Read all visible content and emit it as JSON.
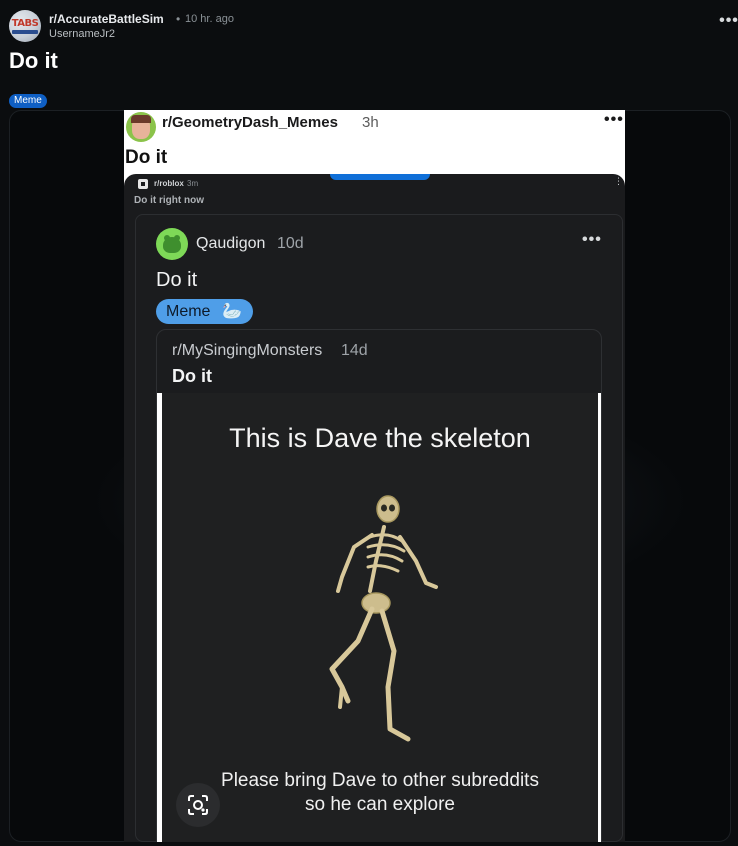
{
  "post": {
    "subreddit": "r/AccurateBattleSim",
    "separator": "•",
    "time": "10 hr. ago",
    "author": "UsernameJr2",
    "avatar_text": "TABS",
    "title": "Do it",
    "flair": "Meme",
    "more_label": "•••"
  },
  "embedded_screenshot": {
    "subreddit": "r/GeometryDash_Memes",
    "time": "3h",
    "title": "Do it",
    "more_label": "•••",
    "phone": {
      "subreddit": "r/roblox",
      "time": "3m",
      "title": "Do it right now",
      "more_label": "⋮",
      "inner_post": {
        "author": "Qaudigon",
        "time": "10d",
        "title": "Do it",
        "flair": "Meme",
        "flair_emoji": "🦢",
        "more_label": "•••",
        "crosspost": {
          "subreddit": "r/MySingingMonsters",
          "time": "14d",
          "title": "Do it",
          "meme_top_text": "This is Dave the skeleton",
          "meme_bottom_line1": "Please bring Dave to other subreddits",
          "meme_bottom_line2": "so he can explore"
        }
      }
    }
  },
  "icons": [
    "overflow-menu-icon",
    "google-lens-icon",
    "skeleton-image",
    "roblox-icon"
  ],
  "colors": {
    "background": "#0b0d0f",
    "flair_blue": "#0f5fc4",
    "inner_flair_blue": "#4f9ee8",
    "card_dark": "#1b1c1e"
  }
}
